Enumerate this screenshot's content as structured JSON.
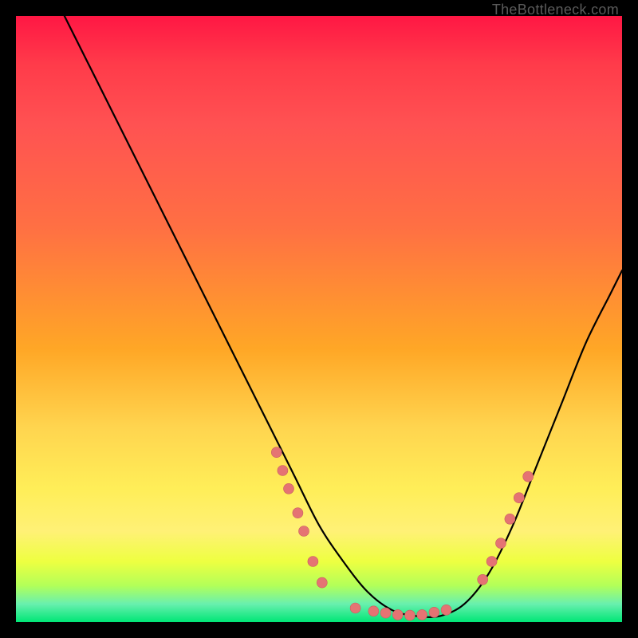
{
  "watermark": "TheBottleneck.com",
  "chart_data": {
    "type": "line",
    "title": "",
    "xlabel": "",
    "ylabel": "",
    "xlim": [
      0,
      100
    ],
    "ylim": [
      0,
      100
    ],
    "grid": false,
    "legend": false,
    "series": [
      {
        "name": "curve",
        "x": [
          8,
          12,
          18,
          24,
          30,
          36,
          42,
          46,
          50,
          54,
          58,
          62,
          66,
          70,
          74,
          78,
          82,
          86,
          90,
          94,
          98,
          100
        ],
        "y": [
          100,
          92,
          80,
          68,
          56,
          44,
          32,
          24,
          16,
          10,
          5,
          2,
          1,
          1,
          3,
          8,
          16,
          26,
          36,
          46,
          54,
          58
        ]
      }
    ],
    "markers": {
      "left_cluster": {
        "x": [
          43,
          44,
          45,
          46.5,
          47.5,
          49,
          50.5
        ],
        "y": [
          28,
          25,
          22,
          18,
          15,
          10,
          6.5
        ]
      },
      "bottom_cluster": {
        "x": [
          56,
          59,
          61,
          63,
          65,
          67,
          69,
          71
        ],
        "y": [
          2.3,
          1.8,
          1.5,
          1.2,
          1.1,
          1.2,
          1.6,
          2.0
        ]
      },
      "right_cluster": {
        "x": [
          77,
          78.5,
          80,
          81.5,
          83,
          84.5
        ],
        "y": [
          7,
          10,
          13,
          17,
          20.5,
          24
        ]
      }
    },
    "annotations": []
  }
}
